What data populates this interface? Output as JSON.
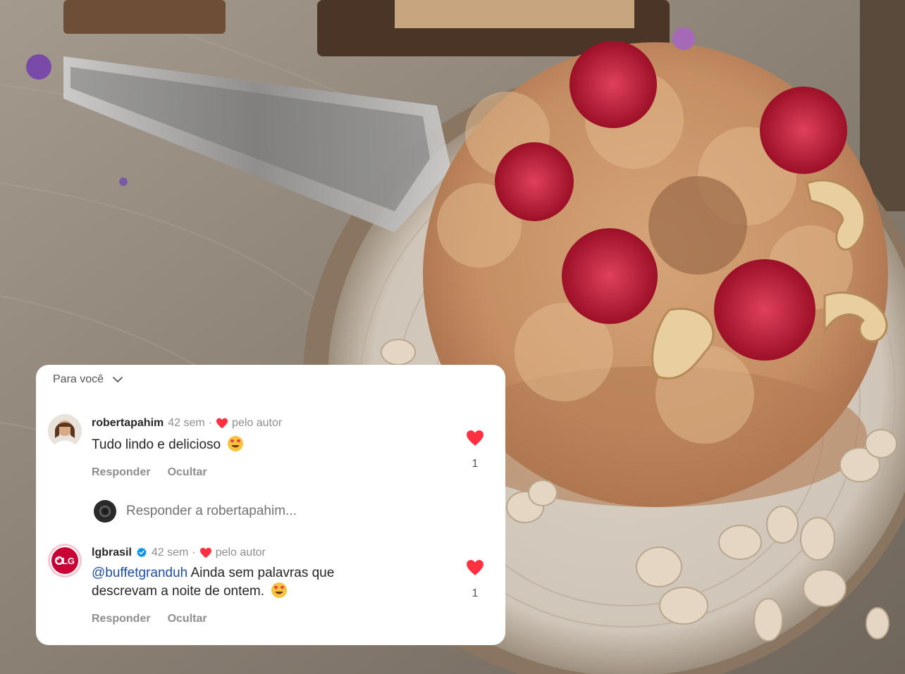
{
  "filter": {
    "label": "Para você"
  },
  "comments": [
    {
      "username": "robertapahim",
      "time": "42 sem",
      "separator": "·",
      "by_author": "pelo autor",
      "text": "Tudo lindo e delicioso",
      "emoji": "heart-eyes-emoji",
      "reply_label": "Responder",
      "hide_label": "Ocultar",
      "likes": "1",
      "liked": true
    },
    {
      "username": "lgbrasil",
      "verified": true,
      "time": "42 sem",
      "separator": "·",
      "by_author": "pelo autor",
      "mention": "@buffetgranduh",
      "text": "Ainda sem palavras que descrevam a noite de ontem.",
      "emoji": "heart-eyes-emoji",
      "reply_label": "Responder",
      "hide_label": "Ocultar",
      "likes": "1",
      "liked": true
    }
  ],
  "reply_box": {
    "placeholder": "Responder a robertapahim..."
  },
  "colors": {
    "like_red": "#ff3040",
    "verified_blue": "#0095f6",
    "lg_red": "#c90036",
    "mention_blue": "#1d4ea8"
  }
}
